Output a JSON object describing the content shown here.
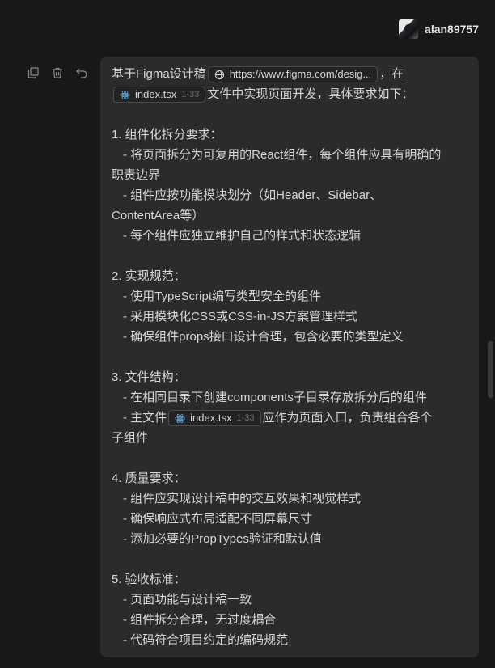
{
  "user": {
    "name": "alan89757",
    "avatar": "user-avatar"
  },
  "actions": [
    {
      "name": "copy-icon"
    },
    {
      "name": "trash-icon"
    },
    {
      "name": "undo-icon"
    }
  ],
  "message": {
    "intro_prefix": "基于Figma设计稿",
    "figma_link": "https://www.figma.com/desig...",
    "intro_suffix": "，在",
    "file_chip_1": {
      "name": "index.tsx",
      "lines": "1-33"
    },
    "intro_line2": "文件中实现页面开发，具体要求如下：",
    "s1_title": "1. 组件化拆分要求：",
    "s1_i1a": "- 将页面拆分为可复用的React组件，每个组件应具有明确的",
    "s1_i1b": "职责边界",
    "s1_i2a": "- 组件应按功能模块划分（如Header、Sidebar、",
    "s1_i2b": "ContentArea等）",
    "s1_i3": "- 每个组件应独立维护自己的样式和状态逻辑",
    "s2_title": "2. 实现规范：",
    "s2_i1": "- 使用TypeScript编写类型安全的组件",
    "s2_i2": "- 采用模块化CSS或CSS-in-JS方案管理样式",
    "s2_i3": "- 确保组件props接口设计合理，包含必要的类型定义",
    "s3_title": "3. 文件结构：",
    "s3_i1": "- 在相同目录下创建components子目录存放拆分后的组件",
    "s3_i2_prefix": "- 主文件",
    "file_chip_2": {
      "name": "index.tsx",
      "lines": "1-33"
    },
    "s3_i2_suffix": "应作为页面入口，负责组合各个",
    "s3_i2b": "子组件",
    "s4_title": "4. 质量要求：",
    "s4_i1": "- 组件应实现设计稿中的交互效果和视觉样式",
    "s4_i2": "- 确保响应式布局适配不同屏幕尺寸",
    "s4_i3": "- 添加必要的PropTypes验证和默认值",
    "s5_title": "5. 验收标准：",
    "s5_i1": "- 页面功能与设计稿一致",
    "s5_i2": "- 组件拆分合理，无过度耦合",
    "s5_i3": "- 代码符合项目约定的编码规范"
  },
  "colors": {
    "background": "#181818",
    "bubble": "#2b2b2b",
    "react_icon": "#4fa3d9"
  }
}
